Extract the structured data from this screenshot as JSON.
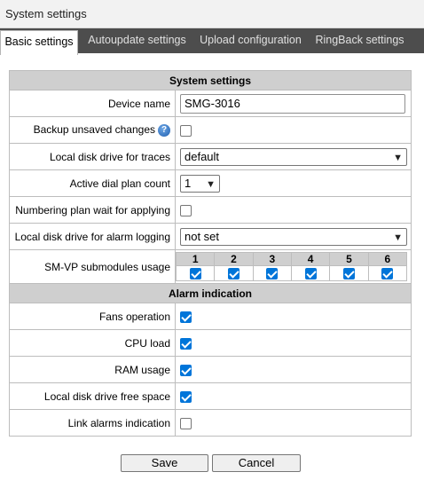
{
  "window": {
    "title": "System settings"
  },
  "tabs": [
    {
      "label": "Basic settings",
      "active": true
    },
    {
      "label": "Autoupdate settings",
      "active": false
    },
    {
      "label": "Upload configuration",
      "active": false
    },
    {
      "label": "RingBack settings",
      "active": false
    }
  ],
  "system_section": {
    "header": "System settings",
    "device_name": {
      "label": "Device name",
      "value": "SMG-3016"
    },
    "backup_unsaved": {
      "label": "Backup unsaved changes",
      "help_icon": "help-icon",
      "checked": false
    },
    "trace_drive": {
      "label": "Local disk drive for traces",
      "selected": "default"
    },
    "dial_plan_count": {
      "label": "Active dial plan count",
      "selected": "1"
    },
    "numbering_wait": {
      "label": "Numbering plan wait for applying",
      "checked": false
    },
    "alarm_log_drive": {
      "label": "Local disk drive for alarm logging",
      "selected": "not set"
    },
    "smvp_usage": {
      "label": "SM-VP submodules usage",
      "modules": [
        {
          "num": "1",
          "checked": true
        },
        {
          "num": "2",
          "checked": true
        },
        {
          "num": "3",
          "checked": true
        },
        {
          "num": "4",
          "checked": true
        },
        {
          "num": "5",
          "checked": true
        },
        {
          "num": "6",
          "checked": true
        }
      ]
    }
  },
  "alarm_section": {
    "header": "Alarm indication",
    "items": [
      {
        "label": "Fans operation",
        "checked": true
      },
      {
        "label": "CPU load",
        "checked": true
      },
      {
        "label": "RAM usage",
        "checked": true
      },
      {
        "label": "Local disk drive free space",
        "checked": true
      },
      {
        "label": "Link alarms indication",
        "checked": false
      }
    ]
  },
  "actions": {
    "save_label": "Save",
    "cancel_label": "Cancel"
  },
  "colors": {
    "tab_bar": "#4d4d4d",
    "section_header": "#cfcfcf",
    "checkbox_checked": "#0075d9"
  }
}
